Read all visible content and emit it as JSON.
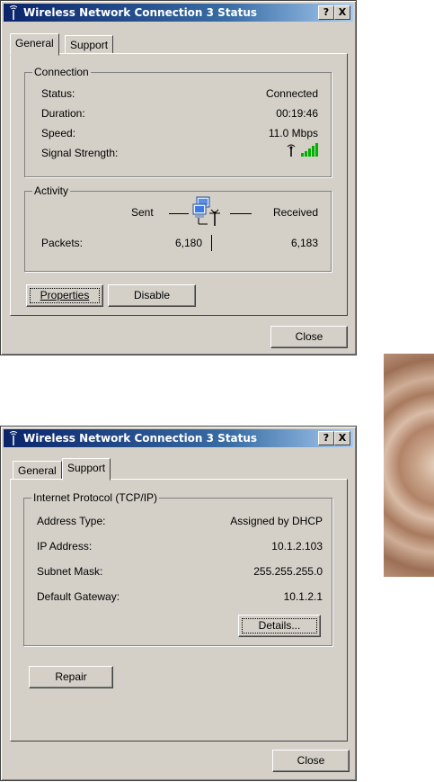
{
  "window1": {
    "title": "Wireless Network Connection 3 Status",
    "help_btn": "?",
    "close_btn": "X",
    "tabs": [
      "General",
      "Support"
    ],
    "connection": {
      "label": "Connection",
      "rows": [
        {
          "label": "Status:",
          "value": "Connected"
        },
        {
          "label": "Duration:",
          "value": "00:19:46"
        },
        {
          "label": "Speed:",
          "value": "11.0 Mbps"
        },
        {
          "label": "Signal Strength:",
          "value": ""
        }
      ]
    },
    "activity": {
      "label": "Activity",
      "sent": "Sent",
      "received": "Received",
      "packets_label": "Packets:",
      "packets_sent": "6,180",
      "packets_received": "6,183"
    },
    "buttons": {
      "properties": "Properties",
      "disable": "Disable",
      "close": "Close"
    }
  },
  "window2": {
    "title": "Wireless Network Connection 3 Status",
    "help_btn": "?",
    "close_btn": "X",
    "tabs": [
      "General",
      "Support"
    ],
    "tcpip": {
      "label": "Internet Protocol (TCP/IP)",
      "rows": [
        {
          "label": "Address Type:",
          "value": "Assigned by DHCP"
        },
        {
          "label": "IP Address:",
          "value": "10.1.2.103"
        },
        {
          "label": "Subnet Mask:",
          "value": "255.255.255.0"
        },
        {
          "label": "Default Gateway:",
          "value": "10.1.2.1"
        }
      ]
    },
    "buttons": {
      "details": "Details...",
      "repair": "Repair",
      "close": "Close"
    }
  },
  "colors": {
    "title_start": "#0a246a",
    "title_end": "#a6caf0",
    "face": "#d4d0c8",
    "signal": "#00b000"
  },
  "icons": {
    "title_icon": "wireless-antenna-icon",
    "signal_icon": "signal-strength-icon",
    "network_icon": "network-computers-icon"
  }
}
